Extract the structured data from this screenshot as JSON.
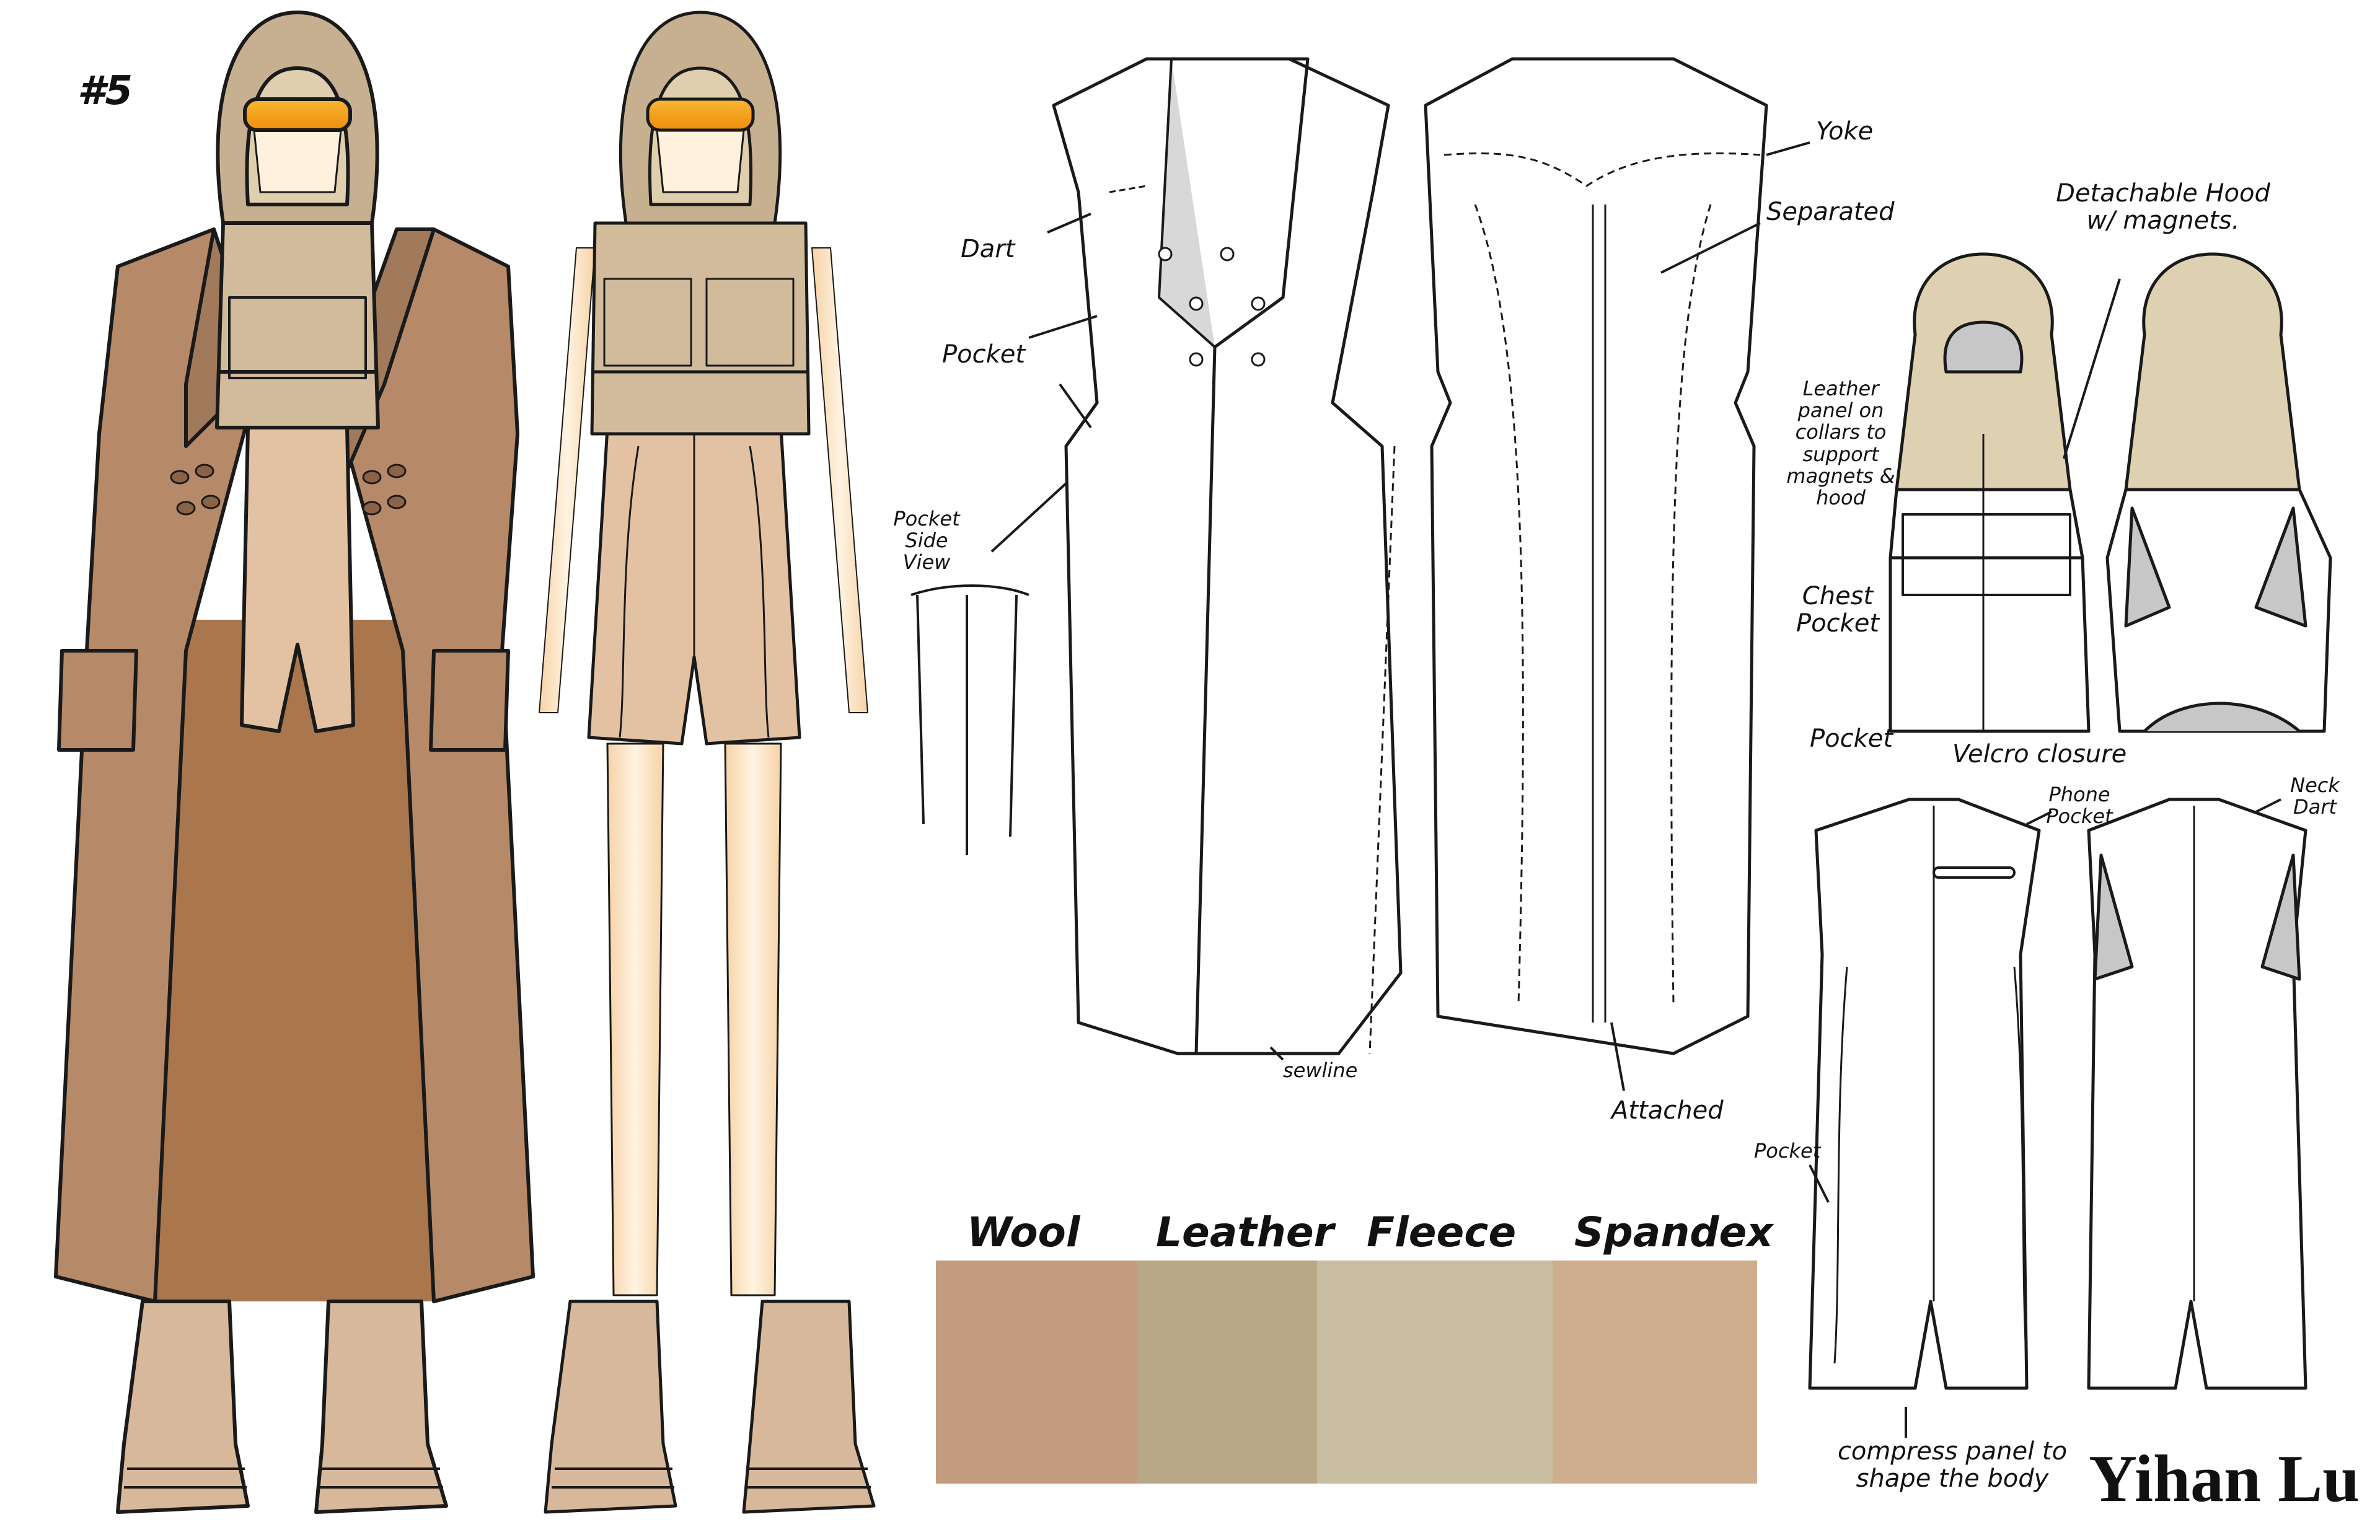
{
  "look_number": "#5",
  "designer": "Yihan Lu",
  "annotations": {
    "dart": "Dart",
    "pocket_coat": "Pocket",
    "pocket_side_view": "Pocket Side View",
    "sewline": "sewline",
    "yoke": "Yoke",
    "separated": "Separated",
    "attached": "Attached",
    "detachable_hood": "Detachable Hood w/ magnets.",
    "leather_panel": "Leather panel on collars to support magnets & hood",
    "chest_pocket": "Chest Pocket",
    "pocket_vest": "Pocket",
    "velcro_closure": "Velcro closure",
    "phone_pocket": "Phone Pocket",
    "neck_dart": "Neck Dart",
    "pocket_romper": "Pocket",
    "compress_panel": "compress panel to shape the body"
  },
  "fabrics": [
    {
      "name": "Wool",
      "color": "#c39c80"
    },
    {
      "name": "Leather",
      "color": "#b9a887"
    },
    {
      "name": "Fleece",
      "color": "#c8bda0"
    },
    {
      "name": "Spandex",
      "color": "#cfae8f"
    }
  ],
  "colors": {
    "coat": "#b68a68",
    "coat_inner": "#a9764d",
    "hood": "#c7b090",
    "romper": "#e3c2a3",
    "skin": "#fbe3c2",
    "visor": "#f2a516",
    "boot": "#d8b89b",
    "lining_gray": "#cfcfcf"
  }
}
